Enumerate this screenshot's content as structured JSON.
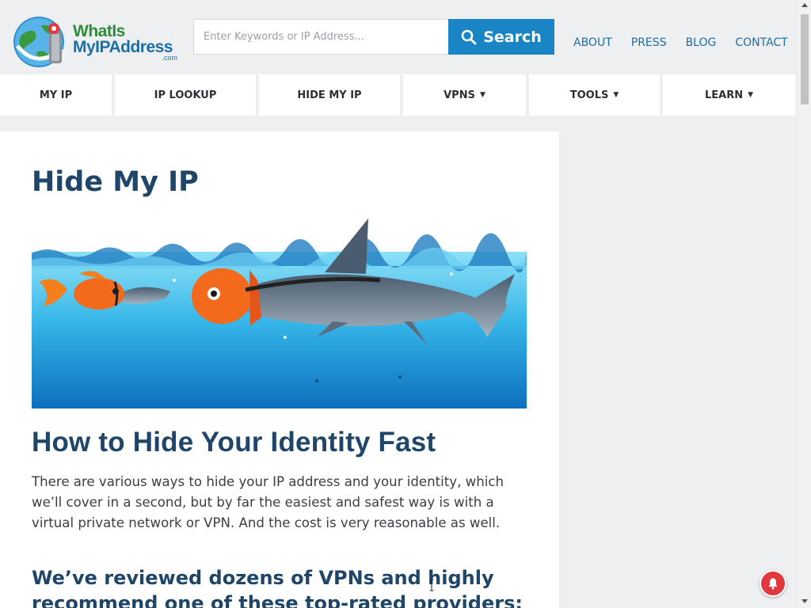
{
  "header": {
    "logo": {
      "line1": "WhatIs",
      "line2": "MyIPAddress",
      "suffix": ".com"
    },
    "search": {
      "placeholder": "Enter Keywords or IP Address...",
      "button_label": "Search"
    },
    "top_links": [
      "ABOUT",
      "PRESS",
      "BLOG",
      "CONTACT"
    ]
  },
  "nav": {
    "items": [
      {
        "label": "MY IP",
        "dropdown": false
      },
      {
        "label": "IP LOOKUP",
        "dropdown": false
      },
      {
        "label": "HIDE MY IP",
        "dropdown": false
      },
      {
        "label": "VPNS",
        "dropdown": true
      },
      {
        "label": "TOOLS",
        "dropdown": true
      },
      {
        "label": "LEARN",
        "dropdown": true
      }
    ],
    "caret": "▼"
  },
  "main": {
    "title": "Hide My IP",
    "heading": "How to Hide Your Identity Fast",
    "paragraph": "There are various ways to hide your IP address and your identity, which we’ll cover in a second, but by far the easiest and safest way is with a virtual private network or VPN. And the cost is very reasonable as well.",
    "subheading": "We’ve reviewed dozens of VPNs and highly recommend one of these top-rated providers:"
  },
  "colors": {
    "brand_blue": "#1a85c4",
    "heading_navy": "#1f4669",
    "link_blue": "#1f6ea3",
    "notification_red": "#e2373d"
  },
  "icons": [
    "globe-logo-icon",
    "search-icon",
    "caret-down-icon",
    "bell-icon"
  ]
}
